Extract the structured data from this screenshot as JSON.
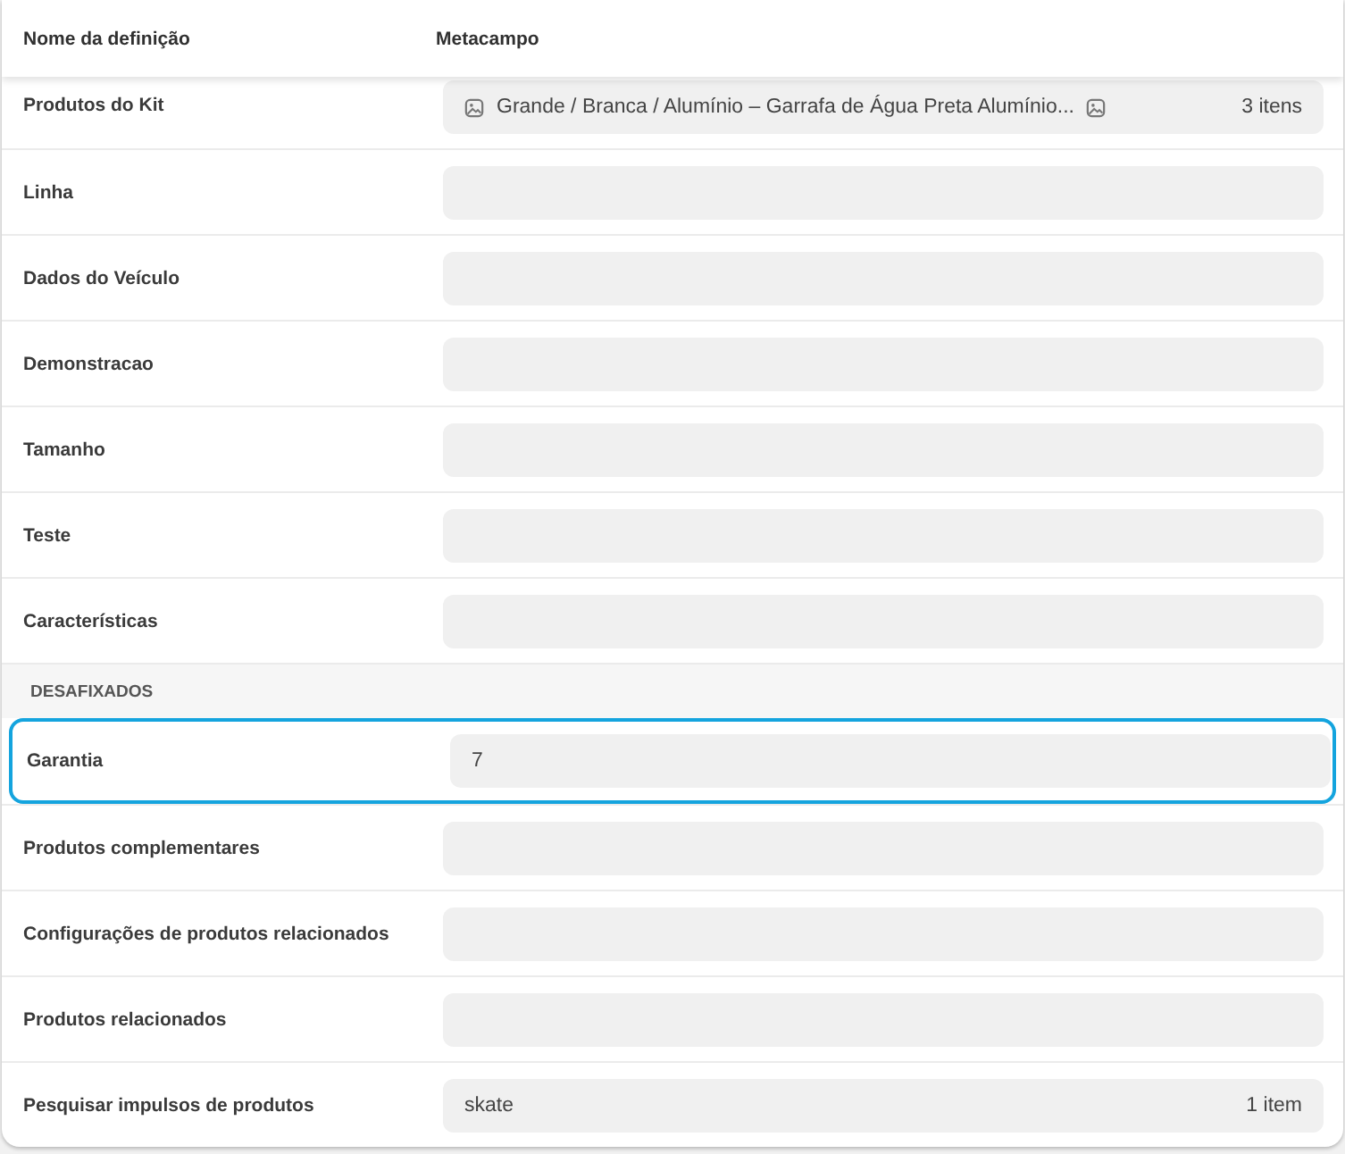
{
  "table": {
    "columns": [
      "Nome da definição",
      "Metacampo"
    ],
    "sections": [
      {
        "rows": [
          {
            "label": "Produtos do Kit",
            "kind": "references",
            "value": "Grande / Branca / Alumínio – Garrafa de Água Preta Alumínio...",
            "count": "3 itens",
            "selected": false
          },
          {
            "label": "Linha",
            "kind": "empty",
            "selected": false
          },
          {
            "label": "Dados do Veículo",
            "kind": "empty",
            "selected": false
          },
          {
            "label": "Demonstracao",
            "kind": "empty",
            "selected": false
          },
          {
            "label": "Tamanho",
            "kind": "empty",
            "selected": false
          },
          {
            "label": "Teste",
            "kind": "empty",
            "selected": false
          },
          {
            "label": "Características",
            "kind": "empty",
            "selected": false
          }
        ]
      },
      {
        "heading": "DESAFIXADOS",
        "rows": [
          {
            "label": "Garantia",
            "kind": "text",
            "value": "7",
            "selected": true
          },
          {
            "label": "Produtos complementares",
            "kind": "empty",
            "selected": false
          },
          {
            "label": "Configurações de produtos relacionados",
            "kind": "empty",
            "selected": false
          },
          {
            "label": "Produtos relacionados",
            "kind": "empty",
            "selected": false
          },
          {
            "label": "Pesquisar impulsos de produtos",
            "kind": "text",
            "value": "skate",
            "count": "1 item",
            "selected": false
          }
        ]
      }
    ]
  }
}
